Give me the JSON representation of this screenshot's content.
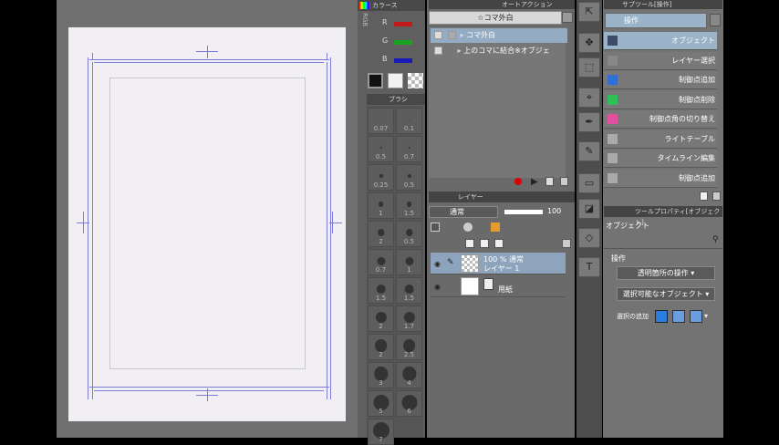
{
  "palette": {
    "tab_label": "カラース",
    "rgb_label": "RGB",
    "r_label": "R",
    "g_label": "G",
    "b_label": "B",
    "brush_tab": "ブラシ"
  },
  "brush_sizes": [
    "0.07",
    "0.1",
    "0.5",
    "0.7",
    "0.25",
    "0.5",
    "1",
    "1.5",
    "2",
    "0.5",
    "0.7",
    "1",
    "1.5",
    "1.5",
    "2",
    "1.7",
    "2",
    "2.5",
    "3",
    "4",
    "5",
    "6",
    "7"
  ],
  "auto_action": {
    "tab_label": "オートアクション",
    "set_name": "☆コマ外白",
    "items": [
      {
        "label": "コマ外白",
        "selected": true
      },
      {
        "label": "上のコマに結合※オブジェ",
        "selected": false
      }
    ]
  },
  "layer_panel": {
    "tab_label": "レイヤー",
    "blend_mode": "通常",
    "opacity": "100",
    "layers": [
      {
        "line1": "100 % 通常",
        "line2": "レイヤー 1",
        "selected": true
      },
      {
        "line1": "用紙",
        "line2": "",
        "selected": false
      }
    ]
  },
  "sub_tool": {
    "tab_label": "サブツール[操作]",
    "header": "操作",
    "items": [
      {
        "label": "オブジェクト",
        "icon": "object-arrow-icon",
        "color": "#3b4c66",
        "selected": true
      },
      {
        "label": "レイヤー選択",
        "icon": "layer-select-icon",
        "color": "#888",
        "selected": false
      },
      {
        "label": "制御点追加",
        "icon": "add-point-icon",
        "color": "#2f6fd6",
        "selected": false
      },
      {
        "label": "制御点削除",
        "icon": "delete-point-icon",
        "color": "#2fbf5a",
        "selected": false
      },
      {
        "label": "制御点角の切り替え",
        "icon": "toggle-corner-icon",
        "color": "#e04fa0",
        "selected": false
      },
      {
        "label": "ライトテーブル",
        "icon": "light-table-icon",
        "color": "#aaa",
        "selected": false
      },
      {
        "label": "タイムライン編集",
        "icon": "timeline-icon",
        "color": "#aaa",
        "selected": false
      },
      {
        "label": "制御点追加",
        "icon": "add-point-icon",
        "color": "#aaa",
        "selected": false
      }
    ]
  },
  "tool_property": {
    "tab_label": "ツールプロパティ[オブジェクト]",
    "name": "オブジェクト",
    "section": "操作",
    "dropdown1": "透明箇所の操作",
    "dropdown2": "選択可能なオブジェクト",
    "selection_label": "選択の追加"
  }
}
